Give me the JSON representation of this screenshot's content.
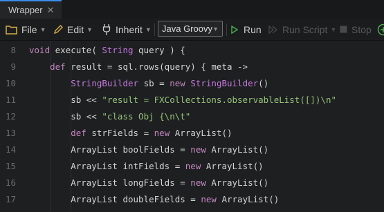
{
  "tab": {
    "title": "Wrapper",
    "close_glyph": "✕"
  },
  "toolbar": {
    "file": "File",
    "edit": "Edit",
    "inherit": "Inherit",
    "language": "Java Groovy",
    "run": "Run",
    "run_script": "Run Script",
    "stop": "Stop"
  },
  "colors": {
    "accent": "#3b8eea",
    "run_green": "#4caf50",
    "keyword": "#c586c0",
    "string": "#98c379"
  },
  "editor": {
    "lines": [
      {
        "num": "8",
        "tokens": [
          [
            "kw",
            "void"
          ],
          [
            "p",
            " execute( "
          ],
          [
            "ty",
            "String"
          ],
          [
            "p",
            " query ) {"
          ]
        ]
      },
      {
        "num": "9",
        "tokens": [
          [
            "p",
            "    "
          ],
          [
            "kw",
            "def"
          ],
          [
            "p",
            " result = sql.rows(query) { meta ->"
          ]
        ]
      },
      {
        "num": "10",
        "tokens": [
          [
            "p",
            "        "
          ],
          [
            "ty",
            "StringBuilder"
          ],
          [
            "p",
            " sb = "
          ],
          [
            "kw",
            "new"
          ],
          [
            "p",
            " "
          ],
          [
            "ty",
            "StringBuilder"
          ],
          [
            "p",
            "()"
          ]
        ]
      },
      {
        "num": "11",
        "tokens": [
          [
            "p",
            "        sb << "
          ],
          [
            "str",
            "\"result = FXCollections.observableList([])\\n\""
          ]
        ]
      },
      {
        "num": "12",
        "tokens": [
          [
            "p",
            "        sb << "
          ],
          [
            "str",
            "\"class Obj {\\n\\t\""
          ]
        ]
      },
      {
        "num": "13",
        "tokens": [
          [
            "p",
            "        "
          ],
          [
            "kw",
            "def"
          ],
          [
            "p",
            " strFields = "
          ],
          [
            "kw",
            "new"
          ],
          [
            "p",
            " ArrayList()"
          ]
        ]
      },
      {
        "num": "14",
        "tokens": [
          [
            "p",
            "        ArrayList boolFields = "
          ],
          [
            "kw",
            "new"
          ],
          [
            "p",
            " ArrayList()"
          ]
        ]
      },
      {
        "num": "15",
        "tokens": [
          [
            "p",
            "        ArrayList intFields = "
          ],
          [
            "kw",
            "new"
          ],
          [
            "p",
            " ArrayList()"
          ]
        ]
      },
      {
        "num": "16",
        "tokens": [
          [
            "p",
            "        ArrayList longFields = "
          ],
          [
            "kw",
            "new"
          ],
          [
            "p",
            " ArrayList()"
          ]
        ]
      },
      {
        "num": "17",
        "tokens": [
          [
            "p",
            "        ArrayList doubleFields = "
          ],
          [
            "kw",
            "new"
          ],
          [
            "p",
            " ArrayList()"
          ]
        ]
      }
    ]
  }
}
